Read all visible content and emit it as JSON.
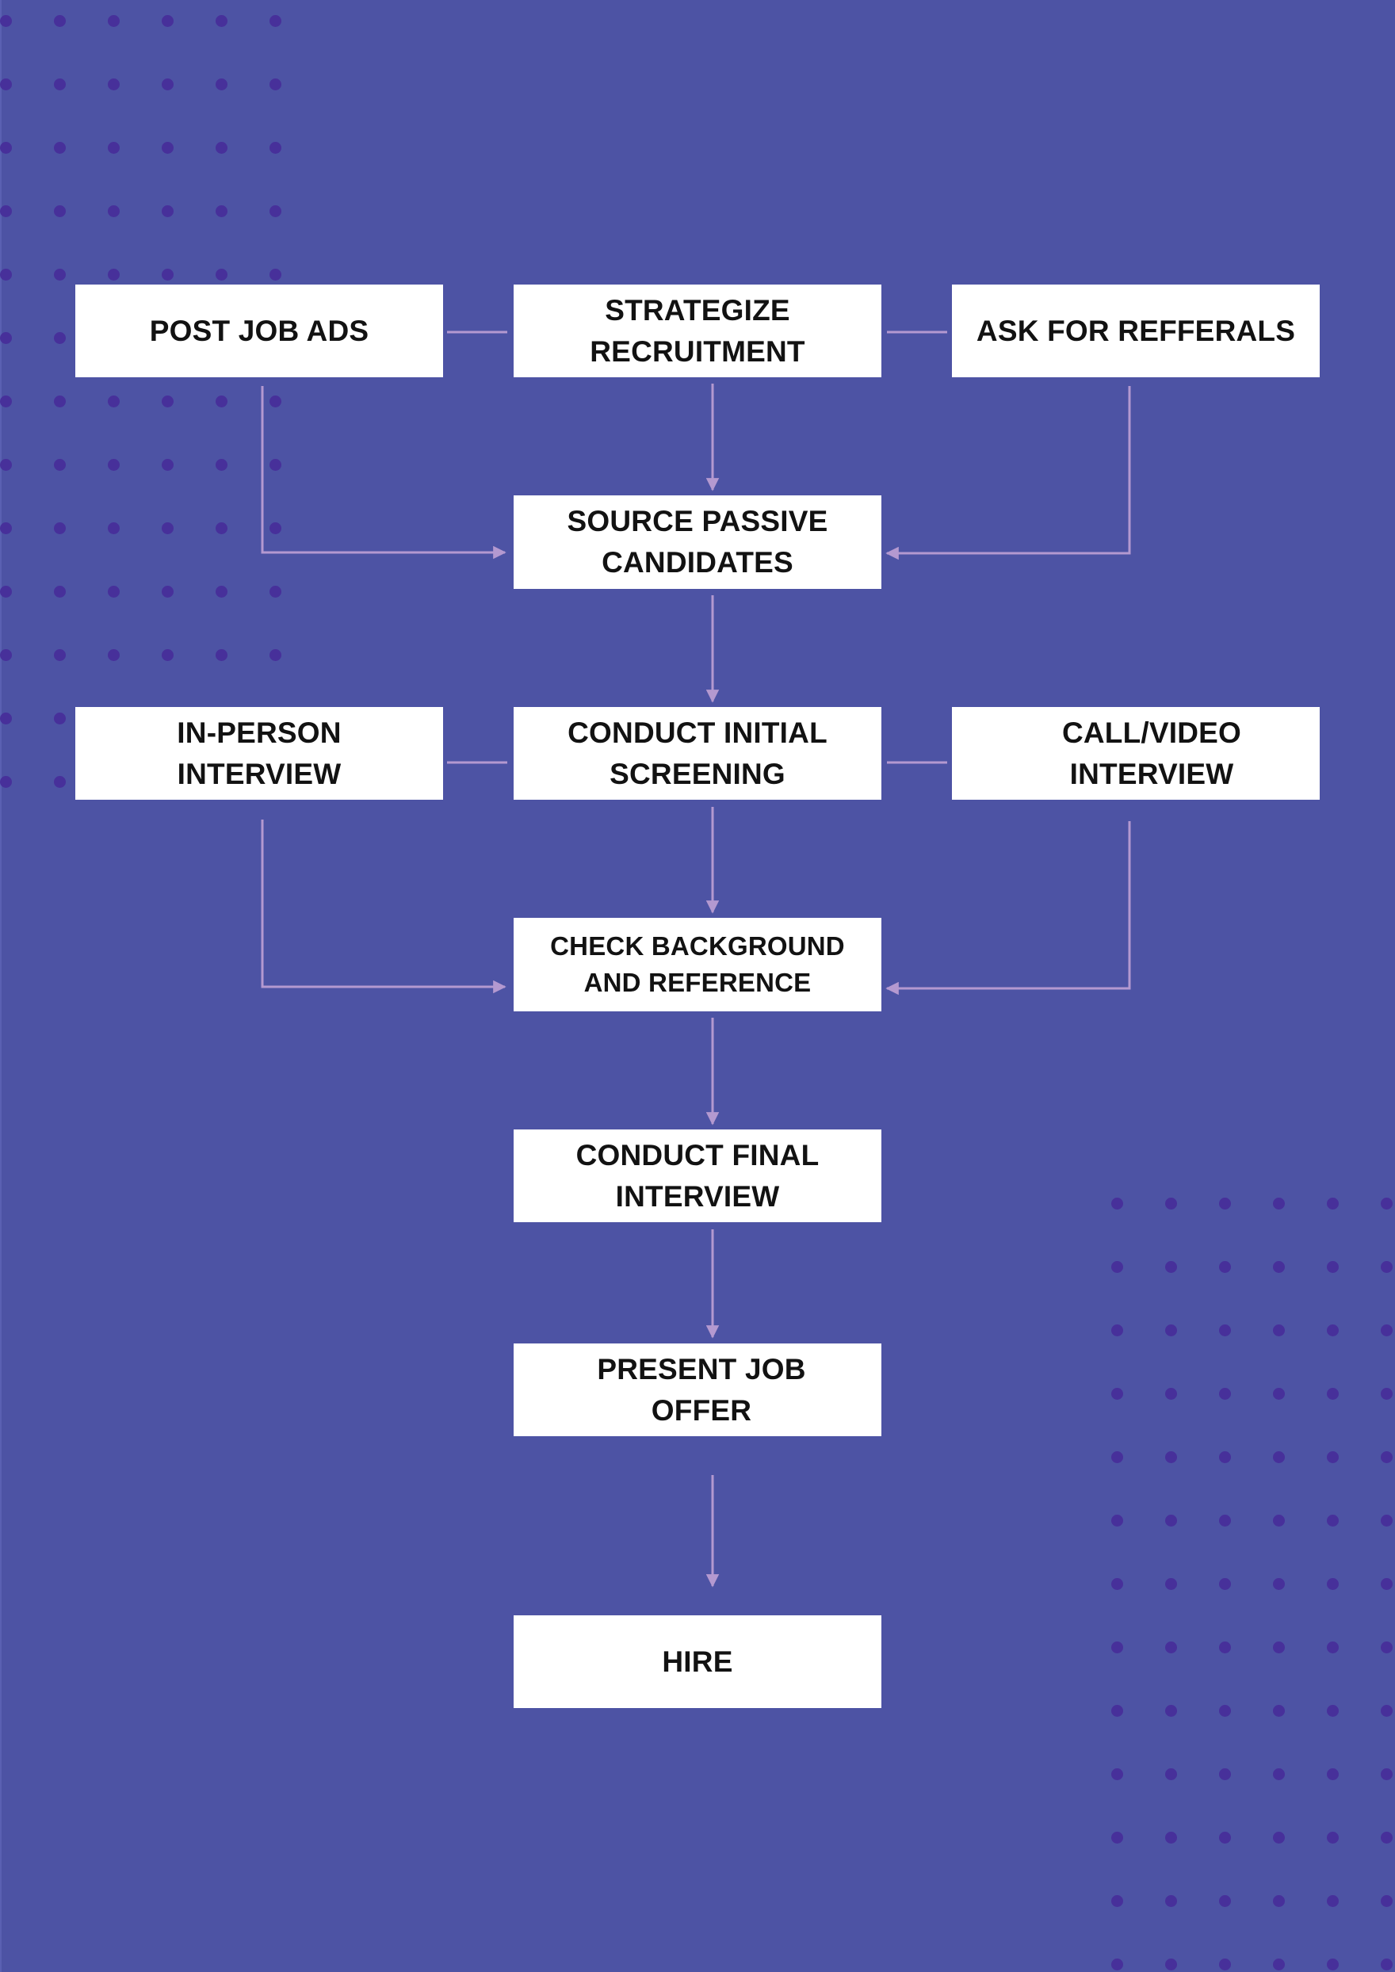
{
  "colors": {
    "background": "#4d53a4",
    "dots": "#47309a",
    "box": "#ffffff",
    "text": "#121212",
    "connector": "#b499d0"
  },
  "nodes": {
    "post_job_ads": "POST JOB ADS",
    "strategize_recruitment": "STRATEGIZE\nRECRUITMENT",
    "ask_for_referrals": "ASK FOR REFFERALS",
    "source_passive_candidates": "SOURCE PASSIVE\nCANDIDATES",
    "in_person_interview": "IN-PERSON\nINTERVIEW",
    "conduct_initial_screening": "CONDUCT INITIAL\nSCREENING",
    "call_video_interview": "CALL/VIDEO\nINTERVIEW",
    "check_background": "CHECK BACKGROUND\nAND REFERENCE",
    "conduct_final_interview": "CONDUCT FINAL\nINTERVIEW",
    "present_job_offer": "PRESENT JOB\nOFFER",
    "hire": "HIRE"
  },
  "edges": [
    {
      "from": "post_job_ads",
      "to": "strategize_recruitment",
      "type": "line"
    },
    {
      "from": "strategize_recruitment",
      "to": "ask_for_referrals",
      "type": "line"
    },
    {
      "from": "strategize_recruitment",
      "to": "source_passive_candidates",
      "type": "arrow"
    },
    {
      "from": "post_job_ads",
      "to": "source_passive_candidates",
      "type": "elbow-arrow"
    },
    {
      "from": "ask_for_referrals",
      "to": "source_passive_candidates",
      "type": "elbow-arrow"
    },
    {
      "from": "source_passive_candidates",
      "to": "conduct_initial_screening",
      "type": "arrow"
    },
    {
      "from": "in_person_interview",
      "to": "conduct_initial_screening",
      "type": "line"
    },
    {
      "from": "conduct_initial_screening",
      "to": "call_video_interview",
      "type": "line"
    },
    {
      "from": "conduct_initial_screening",
      "to": "check_background",
      "type": "arrow"
    },
    {
      "from": "in_person_interview",
      "to": "check_background",
      "type": "elbow-arrow"
    },
    {
      "from": "call_video_interview",
      "to": "check_background",
      "type": "elbow-arrow"
    },
    {
      "from": "check_background",
      "to": "conduct_final_interview",
      "type": "arrow"
    },
    {
      "from": "conduct_final_interview",
      "to": "present_job_offer",
      "type": "arrow"
    },
    {
      "from": "present_job_offer",
      "to": "hire",
      "type": "arrow"
    }
  ]
}
